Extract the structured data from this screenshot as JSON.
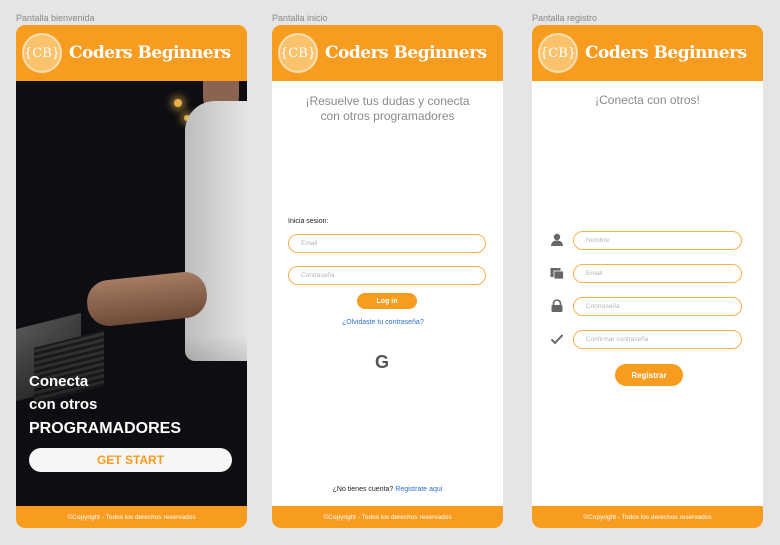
{
  "frames": [
    {
      "label": "Pantalla bienvenida",
      "brand": "Coders Beginners",
      "logo_text": "{CB}",
      "hero": {
        "line1": "Conecta",
        "line2": "con otros",
        "line3": "PROGRAMADORES"
      },
      "button": "GET START",
      "footer": "©Copyright - Todos los derechos reservados"
    },
    {
      "label": "Pantalla inicio",
      "brand": "Coders Beginners",
      "logo_text": "{CB}",
      "headline_1": "¡Resuelve tus dudas y conecta",
      "headline_2": "con otros programadores",
      "login_label": "Inicia sesion:",
      "email_placeholder": "Email",
      "password_placeholder": "Contraseña",
      "login_button": "Log in",
      "forgot_link": "¿Olvidaste tu contraseña?",
      "google_glyph": "G",
      "no_account": "¿No tienes cuenta?",
      "register_link": "Registrate aqui",
      "footer": "©Copyright - Todos los derechos reservados"
    },
    {
      "label": "Pantalla registro",
      "brand": "Coders Beginners",
      "logo_text": "{CB}",
      "headline": "¡Conecta con otros!",
      "name_placeholder": "Nombre",
      "email_placeholder": "Email",
      "password_placeholder": "Contraseña",
      "confirm_placeholder": "Confirmar contraseña",
      "register_button": "Registrar",
      "footer": "©Copyright - Todos los derechos reservados"
    }
  ],
  "colors": {
    "primary": "#f89c20",
    "link": "#2f6fd1",
    "background": "#e5e5e5"
  },
  "icons": [
    "user-icon",
    "email-card-icon",
    "lock-icon",
    "check-icon",
    "google-icon"
  ]
}
